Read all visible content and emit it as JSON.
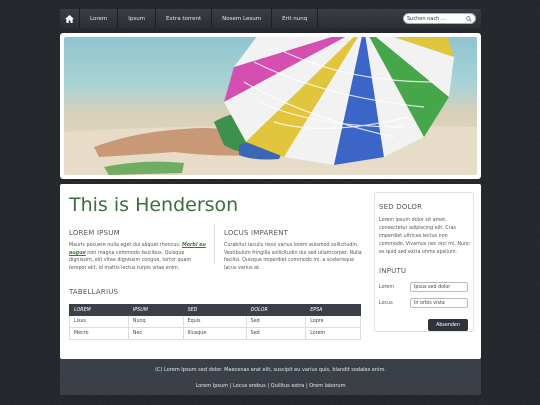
{
  "nav": {
    "items": [
      "Lorem",
      "Ipsum",
      "Extra torrent",
      "Nosem Lesum",
      "Erit nunq"
    ],
    "search_placeholder": "Suchen nach ..."
  },
  "main": {
    "title": "This is Henderson",
    "col1": {
      "heading": "LOREM IPSUM",
      "text_before": "Mauris posuere nulla eget dui aliquet rhoncus. ",
      "link": "Morbi eu augue",
      "text_after": " non magna commodo faucibus. Quisque dignissim, elit vitae dignissim congue, tortor quam tempor elit, id mattis lectus turpis vitae enim."
    },
    "col2": {
      "heading": "LOCUS IMPARENT",
      "text": "Curabitur iaculis risus varius lorem euismod sollicitudin. Vestibulum fringilla sollicitudin dui sed ullamcorper. Nulla facilisi. Quisque imperdiet commodo mi, a scelerisque lacus varius at."
    },
    "table": {
      "heading": "TABELLARIUS",
      "columns": [
        "LOREM",
        "IPSUM",
        "SED",
        "DOLOR",
        "EPSA"
      ],
      "rows": [
        [
          "Lisus",
          "Nunq",
          "Equis",
          "Sed",
          "Lopre"
        ],
        [
          "Mecro",
          "Nec",
          "Illusque",
          "Sed",
          "Lorem"
        ]
      ]
    }
  },
  "sidebar": {
    "heading1": "SED DOLOR",
    "text": "Lorem ipsum dolor sit amet, consectetur adipiscing elit. Cras imperdiet ultrices lectus non commodo. Vivamus nec orci mi. Nunc es quid sed extra ohms epsilum.",
    "heading2": "INPUTU",
    "field1_label": "Lorem",
    "field1_value": "Ipsus sed dolor",
    "field2_label": "Locus",
    "field2_value": "In orbis vista",
    "button": "Absenden"
  },
  "footer": {
    "copy": "(C) Lorem Ipsum sed dolor. Maecenas erat elit, suscipit eu varius quis, blandit sodales enim.",
    "links": [
      "Lorem Ipsum",
      "Locus erebus",
      "Quilitus extra",
      "Orem laborum"
    ],
    "separator": " | "
  },
  "colors": {
    "accent_green": "#3c6e3c",
    "dark": "#3b4048",
    "background": "#23272c"
  },
  "icons": [
    "home-icon",
    "search-icon"
  ]
}
